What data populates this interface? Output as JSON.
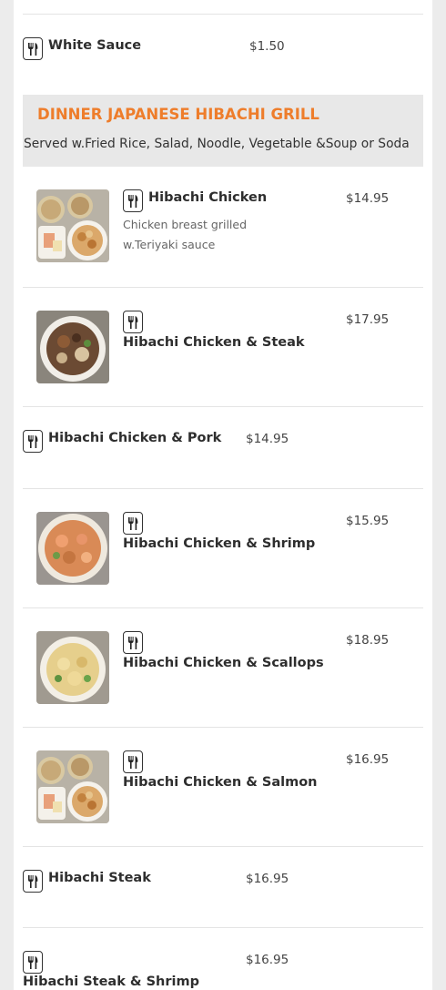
{
  "colors": {
    "accent": "#ee7d2b",
    "page_background": "#ececec",
    "panel_background": "#ffffff",
    "section_header_background": "#e8e8e8"
  },
  "icons": {
    "item_icon": "fork-knife-icon"
  },
  "top_item": {
    "name": "White Sauce",
    "price": "$1.50"
  },
  "section": {
    "title": "DINNER JAPANESE HIBACHI GRILL",
    "subtitle": "Served w.Fried Rice, Salad, Noodle, Vegetable &Soup or Soda"
  },
  "items": [
    {
      "name": "Hibachi Chicken",
      "price": "$14.95",
      "description": "Chicken breast grilled w.Teriyaki sauce"
    },
    {
      "name": "Hibachi Chicken & Steak",
      "price": "$17.95"
    },
    {
      "name": "Hibachi Chicken & Pork",
      "price": "$14.95"
    },
    {
      "name": "Hibachi Chicken & Shrimp",
      "price": "$15.95"
    },
    {
      "name": "Hibachi Chicken & Scallops",
      "price": "$18.95"
    },
    {
      "name": "Hibachi Chicken & Salmon",
      "price": "$16.95"
    },
    {
      "name": "Hibachi Steak",
      "price": "$16.95"
    },
    {
      "name": "Hibachi Steak & Shrimp",
      "price": "$16.95"
    }
  ]
}
